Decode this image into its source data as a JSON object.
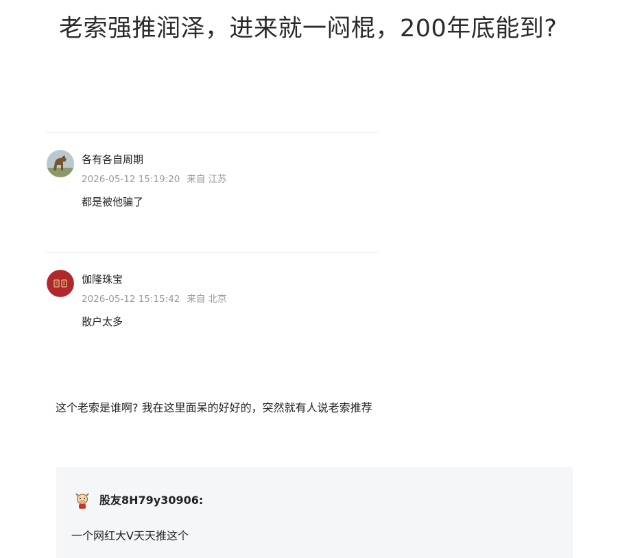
{
  "post": {
    "title": "老索强推润泽，进来就一闷棍，200年底能到?",
    "text": "这个老索是谁啊? 我在这里面呆的好好的，突然就有人说老索推荐"
  },
  "comments": [
    {
      "avatar_icon": "horse-photo-avatar-icon",
      "username": "各有各自周期",
      "timestamp": "2026-05-12 15:19:20",
      "source": "来自 江苏",
      "text": "都是被他骗了"
    },
    {
      "avatar_icon": "jewelry-logo-avatar-icon",
      "avatar_color": "#b0282c",
      "username": "伽隆珠宝",
      "timestamp": "2026-05-12 15:15:42",
      "source": "来自 北京",
      "text": "散户太多"
    }
  ],
  "quote": {
    "avatar_icon": "cow-avatar-icon",
    "username": "股友8H79y30906:",
    "text": "一个网红大V天天推这个"
  }
}
